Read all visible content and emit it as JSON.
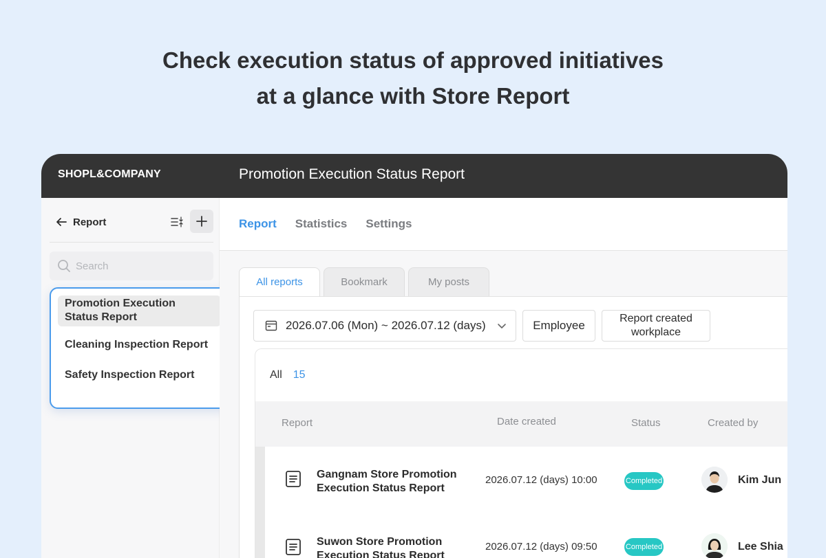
{
  "headline": {
    "line1": "Check execution status of approved initiatives",
    "line2": "at a glance with Store Report"
  },
  "topbar": {
    "brand": "SHOPL&COMPANY",
    "title": "Promotion Execution Status Report"
  },
  "sidebar": {
    "back_label": "Report",
    "sort_icon": "sort-list-icon",
    "add_icon": "plus-icon",
    "search_placeholder": "Search",
    "reports": [
      {
        "line1": "Promotion Execution",
        "line2": "Status Report",
        "active": true
      },
      {
        "label": "Cleaning Inspection Report",
        "active": false
      },
      {
        "label": "Safety Inspection Report",
        "active": false
      }
    ]
  },
  "nav_tabs": [
    {
      "label": "Report",
      "active": true
    },
    {
      "label": "Statistics",
      "active": false
    },
    {
      "label": "Settings",
      "active": false
    }
  ],
  "sub_tabs": [
    {
      "label": "All reports",
      "active": true
    },
    {
      "label": "Bookmark",
      "active": false
    },
    {
      "label": "My posts",
      "active": false
    }
  ],
  "filters": {
    "date_range": "2026.07.06 (Mon) ~ 2026.07.12 (days)",
    "employee": "Employee",
    "workplace_line1": "Report created",
    "workplace_line2": "workplace"
  },
  "summary": {
    "label": "All",
    "count": "15"
  },
  "table": {
    "headers": {
      "report": "Report",
      "date": "Date created",
      "status": "Status",
      "created_by": "Created by"
    },
    "rows": [
      {
        "title_line1": "Gangnam Store Promotion",
        "title_line2": "Execution Status Report",
        "date": "2026.07.12 (days) 10:00",
        "status": "Completed",
        "created_by": "Kim Jun"
      },
      {
        "title_line1": "Suwon Store Promotion",
        "title_line2": "Execution Status Report",
        "date": "2026.07.12 (days) 09:50",
        "status": "Completed",
        "created_by": "Lee Shia"
      }
    ]
  },
  "colors": {
    "background": "#e4effc",
    "topbar": "#343434",
    "accent": "#3c93e6",
    "status_completed": "#27c7c4"
  }
}
